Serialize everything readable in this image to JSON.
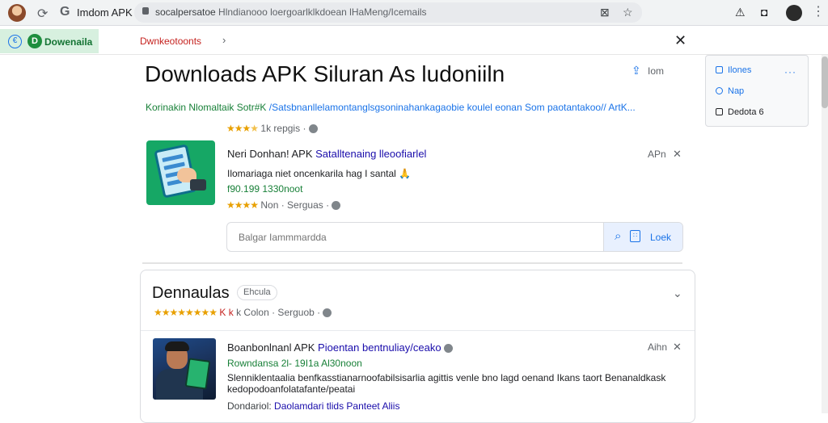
{
  "browser": {
    "tab_title": "Imdom APK",
    "url_host": "socalpersatoe",
    "url_path": " Hlndianooo loergoarlklkdoean lHaMeng/Icemails",
    "icons": [
      "refresh-icon",
      "google-g-icon",
      "lock-icon",
      "translate-icon",
      "star-icon",
      "alert-icon",
      "extension-icon",
      "menu-icon"
    ]
  },
  "toolbar": {
    "extension_label": "Dowenaila",
    "breadcrumb": "Dwnkeotoonts"
  },
  "main": {
    "title": "Downloads APK Siluran As ludoniiln",
    "share_label": "Iom",
    "subtitle_green": "Korinakin Nlomaltaik Sotr#K",
    "subtitle_blue": " /Satsbnanllelamontanglsgsoninahankagaobie koulel eonan Som paotantakoo// ArtK...",
    "top_rating": {
      "stars": 3.5,
      "text": "1k  repgis",
      "dot": "·"
    }
  },
  "results": [
    {
      "title_dark": "Neri Donhan! APK ",
      "title_link": "Satalltenaing lleoofiarlel",
      "desc": "Ilomariaga niet oncenkarila hag I santal",
      "emoji": "🙏",
      "green": "f90.199 1330noot",
      "rating_text": "Non  ·  Serguas  ·",
      "stars": 4,
      "tag": "APn"
    }
  ],
  "search": {
    "placeholder": "Balgar Iammmardda",
    "button_label": "Loek"
  },
  "card": {
    "title": "Dennaulas",
    "chip": "Ehcula",
    "rating_k": "K k",
    "rating_text": " k  Colon  ·  Serguob  ·",
    "stars": 8,
    "item": {
      "title_dark": "Boanbonlnanl APK ",
      "title_link": "Pioentan bentnuliay/ceako",
      "green": "Rowndansa 2l- 19I1a Al30noon",
      "desc1": "Slenniklentaalia benfkasstianarnoofabilsisarlia agittis venle bno lagd oenand Ikans taort Benanaldkask",
      "desc2": "kedopodoanfolatafante/peatai",
      "meta_dark": "Dondariol: ",
      "meta_link": "Daolamdari tlids Panteet Aliis",
      "tag": "Aihn"
    }
  },
  "side_panel": {
    "items": [
      "Ilones",
      "Nap",
      "Dedota 6"
    ],
    "more": "···"
  }
}
